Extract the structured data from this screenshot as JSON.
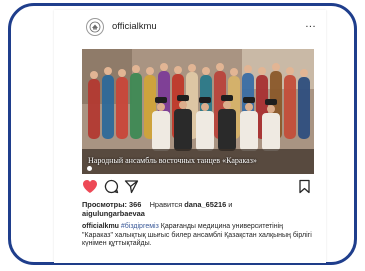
{
  "post": {
    "username": "officialkmu",
    "more_label": "...",
    "photo_caption": "Народный ансамбль восточных танцев «Караказ»",
    "views_label": "Просмотры: 366",
    "liked_prefix": "Нравится",
    "liked_user": "dana_65216",
    "liked_and": "и",
    "liked_second_user": "aigulungarbaevaa",
    "description": {
      "author": "officialkmu",
      "hashtag": "#біздіргеміз",
      "text": "Қарағанды медицина университетінің \"Караказ\" халықтық шығыс билер ансамблі Қазақстан халқының бірлігі күнімен құттықтайды."
    }
  },
  "colors": {
    "frame_border": "#1f3e8c",
    "like_red": "#ed4956",
    "text": "#262626",
    "hashtag": "#3b5a99"
  },
  "icons": {
    "like": "heart-icon",
    "comment": "comment-icon",
    "share": "share-icon",
    "save": "bookmark-icon",
    "more": "more-icon",
    "avatar": "university-emblem-icon"
  }
}
